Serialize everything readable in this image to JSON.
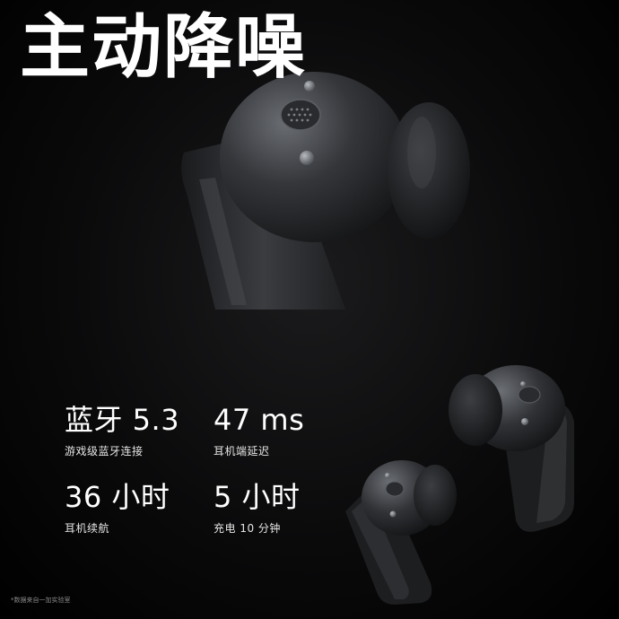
{
  "headline": "主动降噪",
  "specs": [
    {
      "value": "蓝牙 5.3",
      "caption": "游戏级蓝牙连接"
    },
    {
      "value": "47 ms",
      "caption": "耳机端延迟"
    },
    {
      "value": "36 小时",
      "caption": "耳机续航"
    },
    {
      "value": "5 小时",
      "caption": "充电 10 分钟"
    }
  ],
  "footnote": "*数据来自一加实验室",
  "colors": {
    "background": "#000000",
    "text": "#ffffff",
    "earbud": "#2a2c2f"
  }
}
